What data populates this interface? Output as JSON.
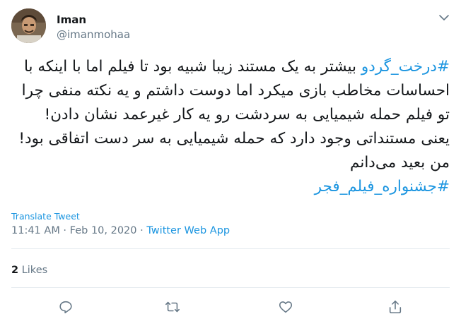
{
  "author": {
    "name": "Iman",
    "handle": "@imanmohaa"
  },
  "tweet": {
    "hashtag_1": "#درخت_گردو",
    "text": " بیشتر به یک مستند زیبا شبیه بود تا فیلم اما با اینکه با احساسات مخاطب بازی میکرد اما دوست داشتم و یه نکته منفی چرا تو فیلم حمله شیمیایی به سردشت رو یه کار غیرعمد نشان دادن! یعنی مستنداتی وجود دارد که حمله شیمیایی به سر دست اتفاقی بود! من بعید می‌دانم",
    "hashtag_2": "#جشنواره_فیلم_فجر"
  },
  "translate_label": "Translate Tweet",
  "meta": {
    "time": "11:41 AM",
    "sep1": " · ",
    "date": "Feb 10, 2020",
    "sep2": " · ",
    "app": "Twitter Web App"
  },
  "stats": {
    "likes_count": "2",
    "likes_label": "Likes"
  },
  "icons": {
    "caret": "chevron-down-icon",
    "reply": "reply-icon",
    "retweet": "retweet-icon",
    "like": "heart-icon",
    "share": "share-icon"
  },
  "colors": {
    "accent": "#1b95e0",
    "muted": "#657786",
    "text": "#14171a"
  }
}
